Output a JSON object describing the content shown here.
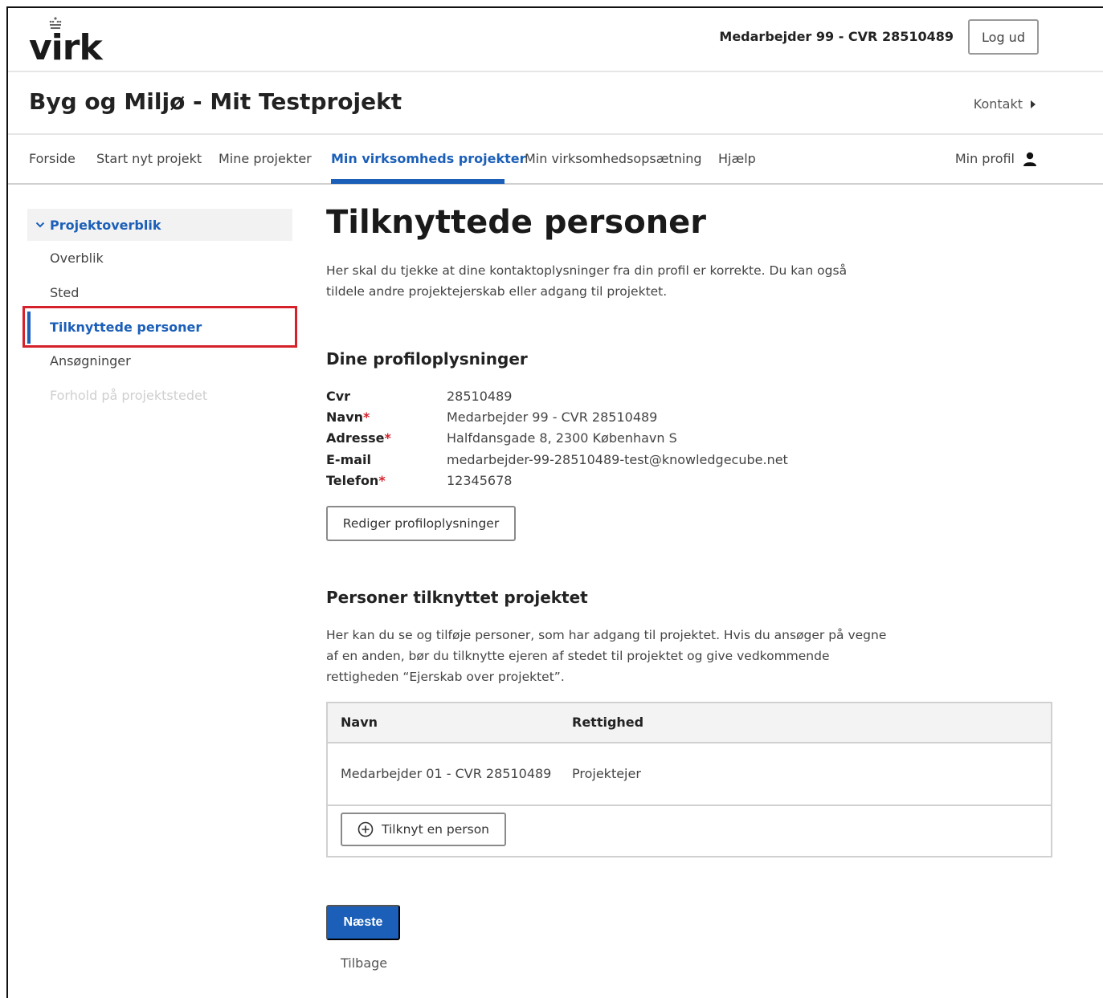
{
  "header": {
    "logo": "virk",
    "user": "Medarbejder 99 - CVR 28510489",
    "logout_label": "Log ud"
  },
  "titlebar": {
    "title": "Byg og Miljø - Mit Testprojekt",
    "contact_label": "Kontakt"
  },
  "nav": {
    "items": [
      {
        "label": "Forside"
      },
      {
        "label": "Start nyt projekt"
      },
      {
        "label": "Mine projekter"
      },
      {
        "label": "Min virksomheds projekter",
        "active": true
      },
      {
        "label": "Min virksomhedsopsætning"
      },
      {
        "label": "Hjælp"
      }
    ],
    "profile_label": "Min profil",
    "accent": "#1b5fb8"
  },
  "sidebar": {
    "section_label": "Projektoverblik",
    "items": [
      {
        "label": "Overblik"
      },
      {
        "label": "Sted"
      },
      {
        "label": "Tilknyttede personer",
        "active": true
      },
      {
        "label": "Ansøgninger"
      },
      {
        "label": "Forhold på projektstedet",
        "disabled": true
      }
    ]
  },
  "main": {
    "title": "Tilknyttede personer",
    "intro": "Her skal du tjekke at dine kontaktoplysninger fra din profil er korrekte. Du kan også tildele andre projektejerskab eller adgang til projektet.",
    "profile_heading": "Dine profiloplysninger",
    "profile": {
      "cvr_label": "Cvr",
      "cvr_value": "28510489",
      "name_label": "Navn",
      "name_value": "Medarbejder 99 - CVR 28510489",
      "address_label": "Adresse",
      "address_value": "Halfdansgade 8, 2300 København S",
      "email_label": "E-mail",
      "email_value": "medarbejder-99-28510489-test@knowledgecube.net",
      "phone_label": "Telefon",
      "phone_value": "12345678",
      "required_marker": "*"
    },
    "edit_profile_label": "Rediger profiloplysninger",
    "persons_heading": "Personer tilknyttet projektet",
    "persons_desc": "Her kan du se og tilføje personer, som har adgang til projektet. Hvis du ansøger på vegne af en anden, bør du tilknytte ejeren af stedet til projektet og give vedkommende rettigheden “Ejerskab over projektet”.",
    "table": {
      "col_name": "Navn",
      "col_right": "Rettighed",
      "rows": [
        {
          "name": "Medarbejder 01 - CVR 28510489",
          "right": "Projektejer"
        }
      ],
      "add_label": "Tilknyt en person"
    },
    "next_label": "Næste",
    "back_label": "Tilbage"
  }
}
